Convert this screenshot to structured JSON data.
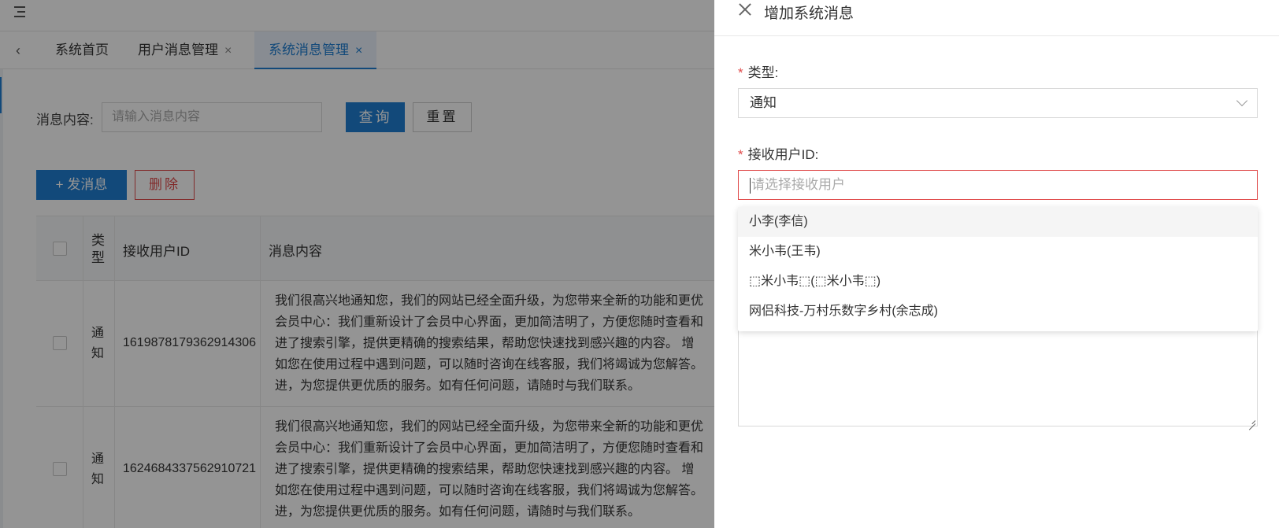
{
  "tabs": [
    {
      "label": "系统首页",
      "closable": false,
      "active": false
    },
    {
      "label": "用户消息管理",
      "closable": true,
      "active": false
    },
    {
      "label": "系统消息管理",
      "closable": true,
      "active": true
    }
  ],
  "search": {
    "label": "消息内容:",
    "placeholder": "请输入消息内容",
    "query_label": "查询",
    "reset_label": "重置"
  },
  "actions": {
    "send_label": "+ 发消息",
    "delete_label": "删除"
  },
  "table": {
    "columns": [
      "类型",
      "接收用户ID",
      "消息内容"
    ],
    "rows": [
      {
        "type": "通知",
        "user_id": "1619878179362914306",
        "content_lines": [
          "我们很高兴地通知您，我们的网站已经全面升级，为您带来全新的功能和更优",
          "会员中心：我们重新设计了会员中心界面，更加简洁明了，方便您随时查看和",
          "进了搜索引擎，提供更精确的搜索结果，帮助您快速找到感兴趣的内容。 增",
          "如您在使用过程中遇到问题，可以随时咨询在线客服，我们将竭诚为您解答。",
          "进，为您提供更优质的服务。如有任何问题，请随时与我们联系。"
        ]
      },
      {
        "type": "通知",
        "user_id": "1624684337562910721",
        "content_lines": [
          "我们很高兴地通知您，我们的网站已经全面升级，为您带来全新的功能和更优",
          "会员中心：我们重新设计了会员中心界面，更加简洁明了，方便您随时查看和",
          "进了搜索引擎，提供更精确的搜索结果，帮助您快速找到感兴趣的内容。 增",
          "如您在使用过程中遇到问题，可以随时咨询在线客服，我们将竭诚为您解答。",
          "进，为您提供更优质的服务。如有任何问题，请随时与我们联系。"
        ]
      }
    ]
  },
  "drawer": {
    "title": "增加系统消息",
    "type_label": "类型:",
    "type_value": "通知",
    "user_label": "接收用户ID:",
    "user_placeholder": "请选择接收用户",
    "user_options": [
      "小李(李信)",
      "米小韦(王韦)",
      "⬚米小韦⬚(⬚米小韦⬚)",
      "网侣科技-万村乐数字乡村(余志成)"
    ]
  },
  "colors": {
    "primary": "#1f7ed2",
    "danger": "#e04a4a",
    "overlay": "rgba(0,0,0,0.42)"
  }
}
